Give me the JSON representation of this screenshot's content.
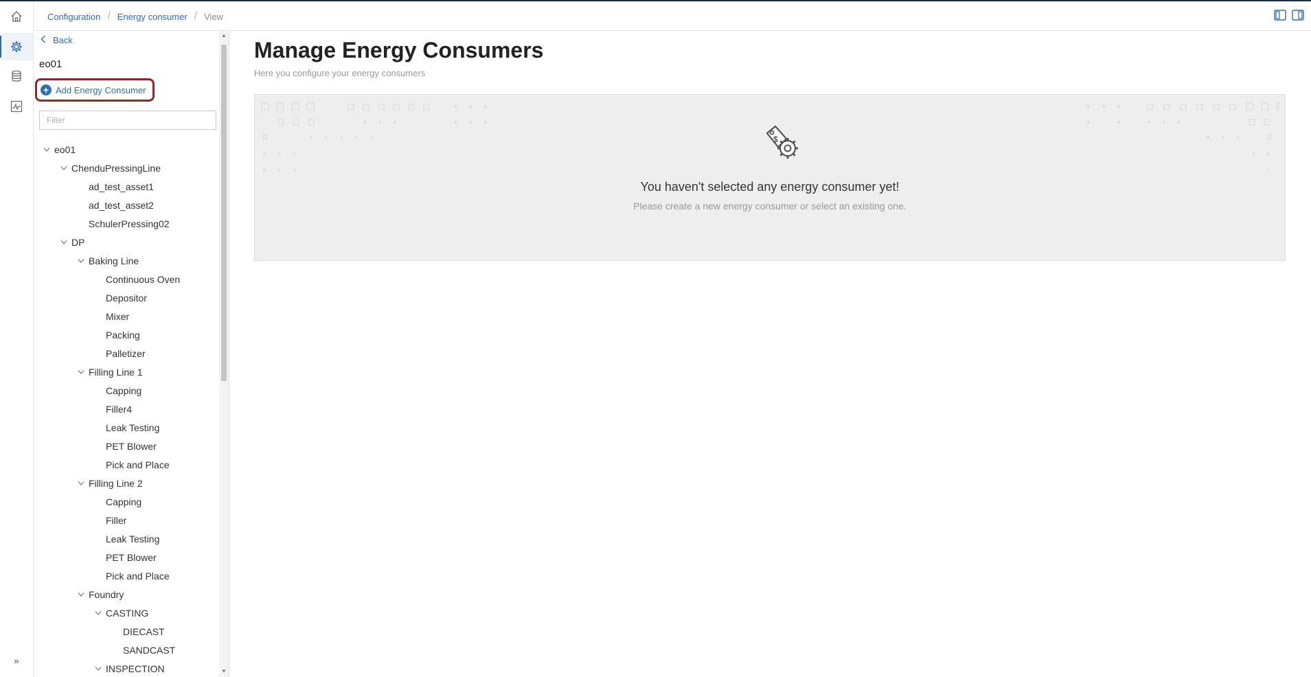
{
  "breadcrumb": {
    "items": [
      "Configuration",
      "Energy consumer"
    ],
    "current": "View"
  },
  "rail": {
    "icons": [
      "home-icon",
      "gear-icon",
      "database-icon",
      "monitor-chart-icon"
    ],
    "active": "gear-icon",
    "expand_label": "»"
  },
  "panel": {
    "back_label": "Back",
    "title": "eo01",
    "add_button_label": "Add Energy Consumer",
    "filter_placeholder": "Filter",
    "tree": [
      {
        "label": "eo01",
        "level": 0,
        "expanded": true
      },
      {
        "label": "ChenduPressingLine",
        "level": 1,
        "expanded": true
      },
      {
        "label": "ad_test_asset1",
        "level": 2
      },
      {
        "label": "ad_test_asset2",
        "level": 2
      },
      {
        "label": "SchulerPressing02",
        "level": 2
      },
      {
        "label": "DP",
        "level": 1,
        "expanded": true
      },
      {
        "label": "Baking Line",
        "level": 2,
        "expanded": true
      },
      {
        "label": "Continuous Oven",
        "level": 3
      },
      {
        "label": "Depositor",
        "level": 3
      },
      {
        "label": "Mixer",
        "level": 3
      },
      {
        "label": "Packing",
        "level": 3
      },
      {
        "label": "Palletizer",
        "level": 3
      },
      {
        "label": "Filling Line 1",
        "level": 2,
        "expanded": true
      },
      {
        "label": "Capping",
        "level": 3
      },
      {
        "label": "Filler4",
        "level": 3
      },
      {
        "label": "Leak Testing",
        "level": 3
      },
      {
        "label": "PET Blower",
        "level": 3
      },
      {
        "label": "Pick and Place",
        "level": 3
      },
      {
        "label": "Filling Line 2",
        "level": 2,
        "expanded": true
      },
      {
        "label": "Capping",
        "level": 3
      },
      {
        "label": "Filler",
        "level": 3
      },
      {
        "label": "Leak Testing",
        "level": 3
      },
      {
        "label": "PET Blower",
        "level": 3
      },
      {
        "label": "Pick and Place",
        "level": 3
      },
      {
        "label": "Foundry",
        "level": 2,
        "expanded": true
      },
      {
        "label": "CASTING",
        "level": 3,
        "expanded": true
      },
      {
        "label": "DIECAST",
        "level": 4
      },
      {
        "label": "SANDCAST",
        "level": 4
      },
      {
        "label": "INSPECTION",
        "level": 3,
        "expanded": true
      }
    ]
  },
  "main": {
    "title": "Manage Energy Consumers",
    "subtitle": "Here you configure your energy consumers",
    "empty_title": "You haven't selected any energy consumer yet!",
    "empty_subtitle": "Please create a new energy consumer or select an existing one.",
    "empty_icon": "gear-dollar-tag-icon"
  },
  "colors": {
    "accent": "#2f6db5",
    "highlight_border": "#8a2a2a",
    "empty_bg": "#eeeeee"
  }
}
